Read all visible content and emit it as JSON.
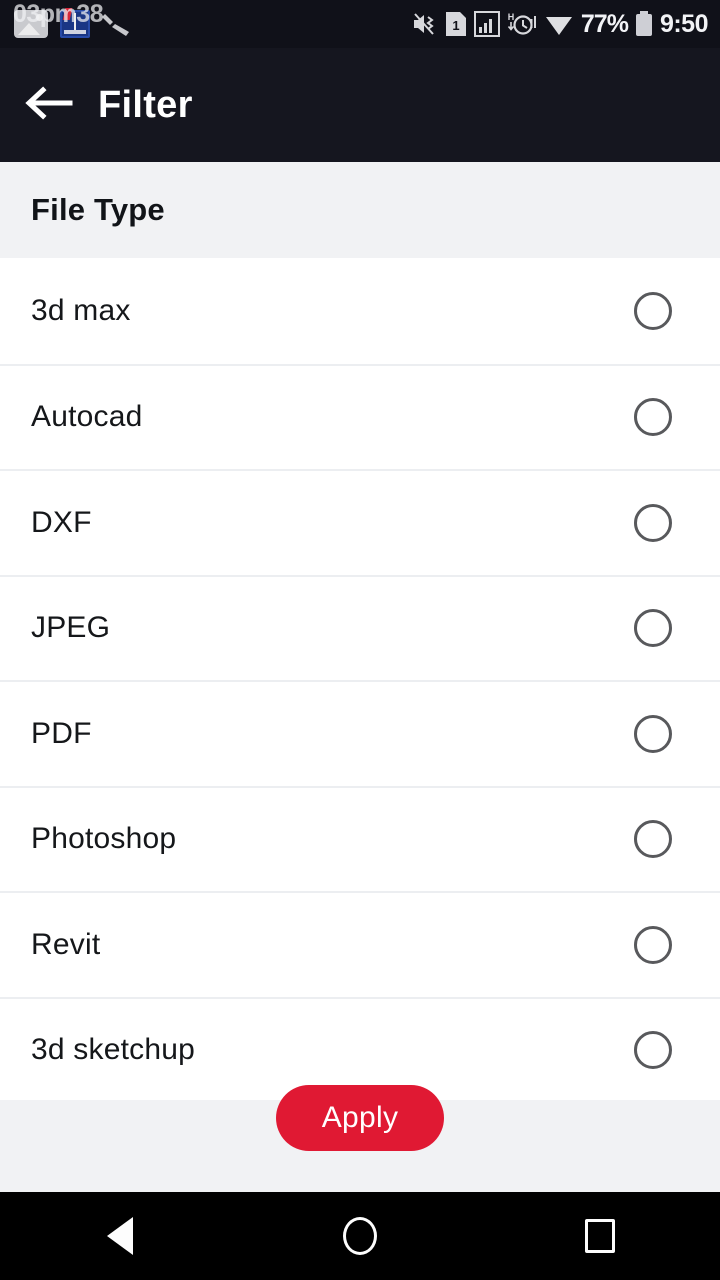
{
  "status_bar": {
    "notifications": [
      {
        "icon": "photo-gallery-icon"
      },
      {
        "icon": "dictionary-book-icon"
      },
      {
        "icon": "magic-wand-icon"
      }
    ],
    "mute_icon": "volume-mute-vibrate-icon",
    "sim_icon": "sim-card-1-icon",
    "signal_icon": "signal-bars-icon",
    "hd_label": "H",
    "alarm_icon": "alarm-clock-icon",
    "wifi_icon": "wifi-icon",
    "battery_icon": "battery-icon",
    "battery_percent": "77%",
    "time": "9:50",
    "time_ghost": "03pm38"
  },
  "app_bar": {
    "back_icon": "arrow-left-icon",
    "title": "Filter"
  },
  "section": {
    "title": "File Type"
  },
  "file_types": [
    {
      "label": "3d max",
      "selected": false
    },
    {
      "label": "Autocad",
      "selected": false
    },
    {
      "label": "DXF",
      "selected": false
    },
    {
      "label": "JPEG",
      "selected": false
    },
    {
      "label": "PDF",
      "selected": false
    },
    {
      "label": "Photoshop",
      "selected": false
    },
    {
      "label": "Revit",
      "selected": false
    },
    {
      "label": "3d sketchup",
      "selected": false
    }
  ],
  "footer": {
    "apply_label": "Apply",
    "apply_color": "#e01933"
  },
  "nav_bar": {
    "back_icon": "nav-back-triangle-icon",
    "home_icon": "nav-home-circle-icon",
    "recents_icon": "nav-recents-square-icon"
  },
  "colors": {
    "status_bar_bg": "#101119",
    "app_bar_bg": "#15161f",
    "section_bg": "#f1f2f4",
    "list_bg": "#ffffff",
    "accent": "#e01933"
  }
}
